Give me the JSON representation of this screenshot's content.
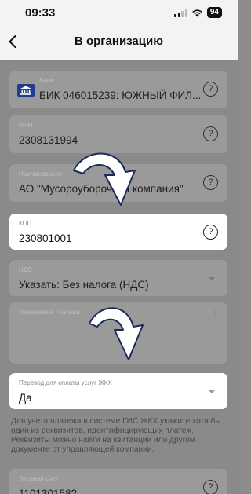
{
  "status_bar": {
    "time": "09:33",
    "battery": "94"
  },
  "nav": {
    "title": "В организацию"
  },
  "fields": {
    "bank": {
      "label": "Банк",
      "value": "БИК 046015239: ЮЖНЫЙ ФИЛ..."
    },
    "inn": {
      "label": "ИНН",
      "value": "2308131994"
    },
    "name": {
      "label": "Наименование",
      "value": "АО \"Мусороуборочная компания\""
    },
    "kpp": {
      "label": "КПП",
      "value": "230801001"
    },
    "nds": {
      "label": "НДС",
      "value": "Указать: Без налога (НДС)"
    },
    "purpose": {
      "label": "Назначение платежа",
      "value": ""
    },
    "gis": {
      "label": "Перевод для оплаты услуг ЖКХ",
      "value": "Да"
    },
    "account": {
      "label": "Лицевой счет",
      "value": "1101301582"
    }
  },
  "info_text": "Для учета платежа в системе ГИС ЖКХ укажите хотя бы один из реквизитов, идентифицирующих платеж. Реквизиты можно найти на квитанции или другом документе от управляющей компании.",
  "help_glyph": "?",
  "colors": {
    "overlay": "#8a8a8a",
    "bank_icon": "#1d3d8f",
    "highlight": "#ffffff"
  }
}
